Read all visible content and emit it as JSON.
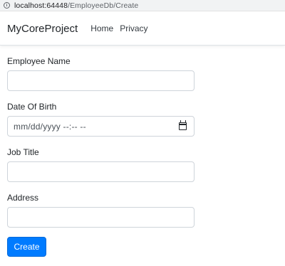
{
  "browser": {
    "url_host": "localhost:64448",
    "url_path": "/EmployeeDb/Create"
  },
  "navbar": {
    "brand": "MyCoreProject",
    "links": [
      "Home",
      "Privacy"
    ]
  },
  "form": {
    "fields": [
      {
        "label": "Employee Name",
        "value": ""
      },
      {
        "label": "Date Of Birth",
        "value": "",
        "display": "mm/dd/yyyy --:-- --"
      },
      {
        "label": "Job Title",
        "value": ""
      },
      {
        "label": "Address",
        "value": ""
      }
    ],
    "submit_label": "Create"
  },
  "colors": {
    "primary": "#007bff",
    "border": "#ced4da"
  },
  "icons": {
    "address_info": "info-icon",
    "date_picker": "calendar-icon"
  }
}
